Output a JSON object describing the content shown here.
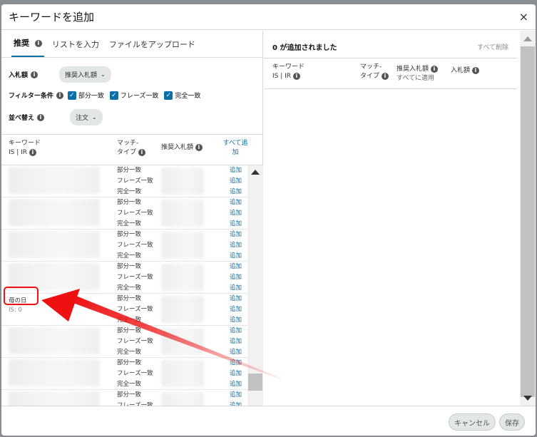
{
  "modal": {
    "title": "キーワードを追加",
    "close": "×"
  },
  "tabs": [
    {
      "label": "推奨",
      "info": "i"
    },
    {
      "label": "リストを入力"
    },
    {
      "label": "ファイルをアップロード"
    }
  ],
  "filters": {
    "bid_label": "入札額",
    "bid_value": "推奨入札額",
    "filter_label": "フィルター条件",
    "checkboxes": [
      "部分一致",
      "フレーズ一致",
      "完全一致"
    ],
    "sort_label": "並べ替え",
    "sort_value": "注文"
  },
  "table": {
    "col_keyword": "キーワード",
    "col_keyword_sub": "IS | IR",
    "col_match_1": "マッチ-",
    "col_match_2": "タイプ",
    "col_bid": "推奨入札額",
    "col_add_1": "すべて追",
    "col_add_2": "加",
    "match_types": [
      "部分一致",
      "フレーズ一致",
      "完全一致"
    ],
    "add_label": "追加",
    "highlight_keyword": "母の日",
    "highlight_sub": "IS: 0"
  },
  "right": {
    "added_count": "0 が追加されました",
    "remove_all": "すべて削除",
    "col_keyword": "キーワード",
    "col_keyword_sub": "IS | IR",
    "col_match_1": "マッチ-",
    "col_match_2": "タイプ",
    "col_suggested": "推奨入札額",
    "col_suggested_sub": "すべてに適用",
    "col_bid": "入札額"
  },
  "footer": {
    "cancel": "キャンセル",
    "save": "保存"
  },
  "colors": {
    "accent": "#0a6fa8",
    "annotation": "#ee1111"
  }
}
